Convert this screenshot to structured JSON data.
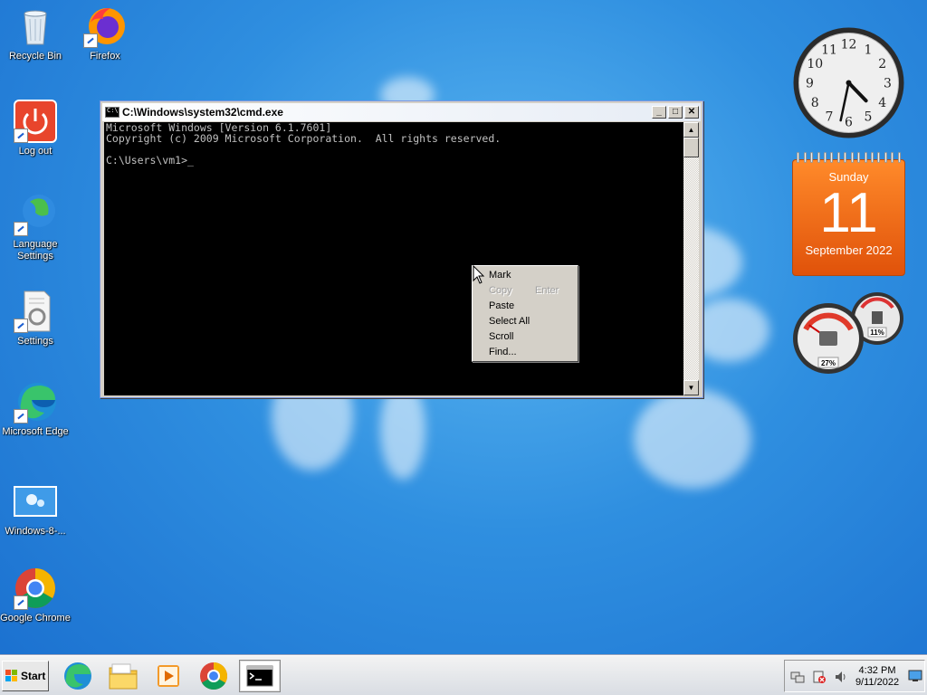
{
  "desktop_icons": [
    {
      "label": "Recycle Bin",
      "icon": "recycle-bin-icon"
    },
    {
      "label": "Firefox",
      "icon": "firefox-icon"
    },
    {
      "label": "Log out",
      "icon": "power-icon"
    },
    {
      "label": "Language Settings",
      "icon": "globe-icon"
    },
    {
      "label": "Settings",
      "icon": "settings-icon"
    },
    {
      "label": "Microsoft Edge",
      "icon": "edge-icon"
    },
    {
      "label": "Windows-8-...",
      "icon": "image-file-icon"
    },
    {
      "label": "Google Chrome",
      "icon": "chrome-icon"
    }
  ],
  "cmd_window": {
    "title": "C:\\Windows\\system32\\cmd.exe",
    "minimize": "_",
    "maximize": "□",
    "close": "✕",
    "console_text": "Microsoft Windows [Version 6.1.7601]\nCopyright (c) 2009 Microsoft Corporation.  All rights reserved.\n\nC:\\Users\\vm1>_",
    "scroll_up": "▲",
    "scroll_down": "▼"
  },
  "context_menu": {
    "items": [
      {
        "label": "Mark",
        "accel": "",
        "enabled": true
      },
      {
        "label": "Copy",
        "accel": "Enter",
        "enabled": false
      },
      {
        "label": "Paste",
        "accel": "",
        "enabled": true
      },
      {
        "label": "Select All",
        "accel": "",
        "enabled": true
      },
      {
        "label": "Scroll",
        "accel": "",
        "enabled": true
      },
      {
        "label": "Find...",
        "accel": "",
        "enabled": true
      }
    ]
  },
  "gadgets": {
    "clock": {
      "hour": 4,
      "minute": 32,
      "numerals": [
        "12",
        "1",
        "2",
        "3",
        "4",
        "5",
        "6",
        "7",
        "8",
        "9",
        "10",
        "11"
      ]
    },
    "calendar": {
      "day_name": "Sunday",
      "date": "11",
      "month_year": "September 2022"
    },
    "cpu_meter": {
      "cpu_percent": 27,
      "cpu_label": "27%",
      "memory_percent": 11,
      "memory_label": "11%"
    }
  },
  "taskbar": {
    "start_label": "Start",
    "pinned": [
      "edge-icon",
      "file-explorer-icon",
      "media-player-icon",
      "chrome-icon",
      "cmd-icon"
    ],
    "clock_time": "4:32 PM",
    "clock_date": "9/11/2022"
  },
  "colors": {
    "accent": "#1a6fcf",
    "calendar": "#f06a14",
    "console_bg": "#000000",
    "console_fg": "#c0c0c0"
  }
}
